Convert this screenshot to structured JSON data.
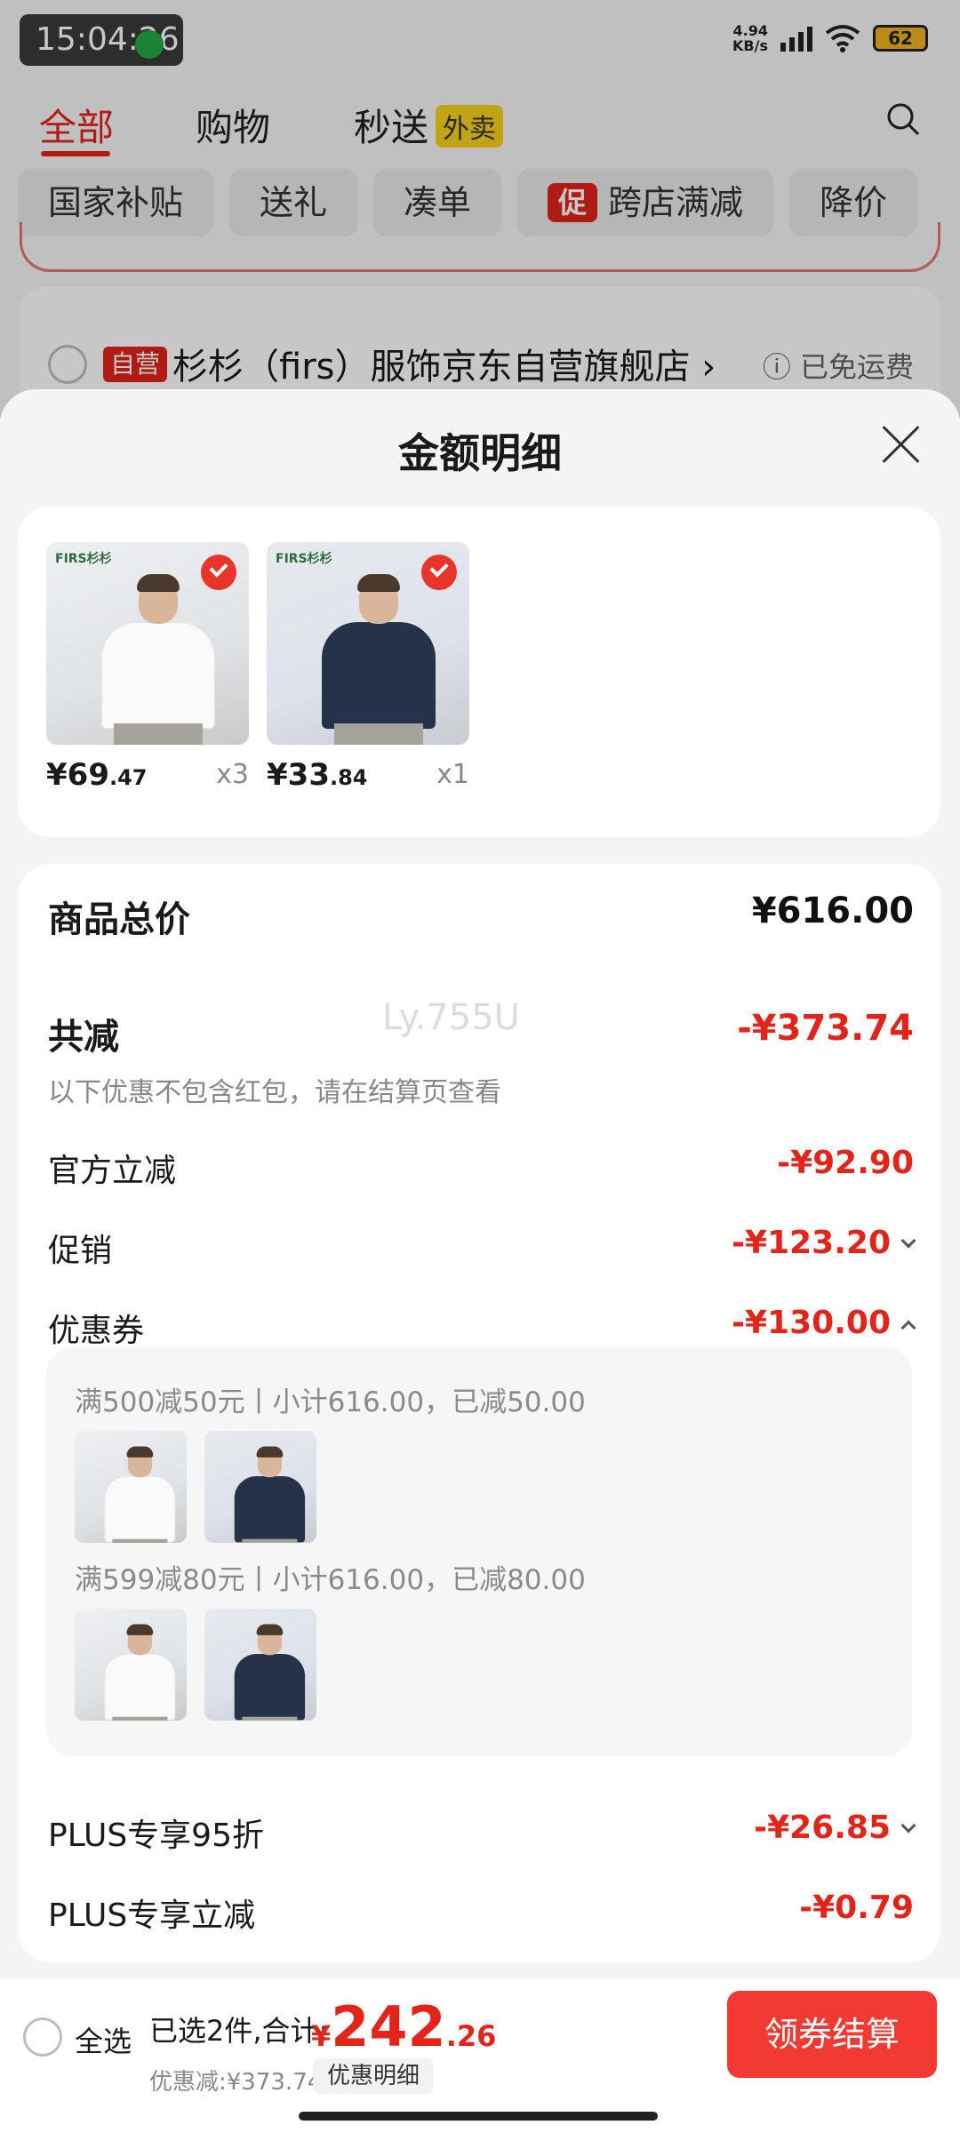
{
  "status_bar": {
    "time": "15:04:26",
    "net_speed_value": "4.94",
    "net_speed_unit": "KB/s",
    "battery": "62"
  },
  "top_nav": {
    "tabs": [
      "全部",
      "购物",
      "秒送"
    ],
    "waimai_badge": "外卖"
  },
  "filter_chips": [
    "国家补贴",
    "送礼",
    "凑单",
    "跨店满减",
    "降价"
  ],
  "promo_badge": "促",
  "store": {
    "tag": "自营",
    "name": "杉杉（firs）服饰京东自营旗舰店 ›",
    "shipping": "ⓘ 已免运费"
  },
  "sheet": {
    "title": "金额明细",
    "products": [
      {
        "brand": "FIRS杉杉",
        "price_int": "¥69",
        "price_dec": ".47",
        "qty": "x3"
      },
      {
        "brand": "FIRS杉杉",
        "price_int": "¥33",
        "price_dec": ".84",
        "qty": "x1"
      }
    ],
    "rows": {
      "total_label": "商品总价",
      "total_value": "¥616.00",
      "reduce_label": "共减",
      "reduce_value": "-¥373.74",
      "reduce_note": "以下优惠不包含红包，请在结算页查看",
      "official_label": "官方立减",
      "official_value": "-¥92.90",
      "promo_label": "促销",
      "promo_value": "-¥123.20",
      "coupon_label": "优惠券",
      "coupon_value": "-¥130.00",
      "plus95_label": "PLUS专享95折",
      "plus95_value": "-¥26.85",
      "plusreduce_label": "PLUS专享立减",
      "plusreduce_value": "-¥0.79"
    },
    "coupons": [
      "满500减50元丨小计616.00，已减50.00",
      "满599减80元丨小计616.00，已减80.00"
    ],
    "watermark": "Ly.755U"
  },
  "bottom_bar": {
    "select_all": "全选",
    "selected": "已选2件,合计:",
    "total_symbol": "¥",
    "total_int": "242",
    "total_dec": ".26",
    "saved": "优惠减:¥373.74",
    "detail_btn": "优惠明细",
    "checkout": "领券结算"
  },
  "colors": {
    "accent": "#e1251b",
    "checkout": "#f23a33"
  }
}
